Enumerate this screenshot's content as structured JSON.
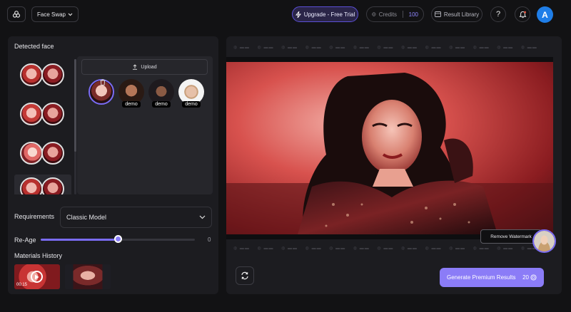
{
  "header": {
    "mode_label": "Face Swap",
    "upgrade_label": "Upgrade - Free Trial",
    "credits_label": "Credits",
    "credits_value": "100",
    "library_label": "Result Library",
    "help_label": "?",
    "avatar_initial": "A"
  },
  "left_panel": {
    "title": "Detected face",
    "upload_label": "Upload",
    "demo_tags": [
      "demo",
      "demo",
      "demo"
    ],
    "requirements_label": "Requirements",
    "model_value": "Classic Model",
    "reage_label": "Re-Age",
    "reage_value": "0",
    "reage_fraction": 0.5,
    "history_title": "Materials History",
    "history_duration": "00:15"
  },
  "right_panel": {
    "remove_watermark_label": "Remove Watermark",
    "generate_label": "Generate Premium Results",
    "generate_cost": "20"
  },
  "colors": {
    "accent": "#8b7cf7",
    "avatar": "#1f7ee8",
    "panel": "#1c1c20",
    "background": "#121214"
  }
}
